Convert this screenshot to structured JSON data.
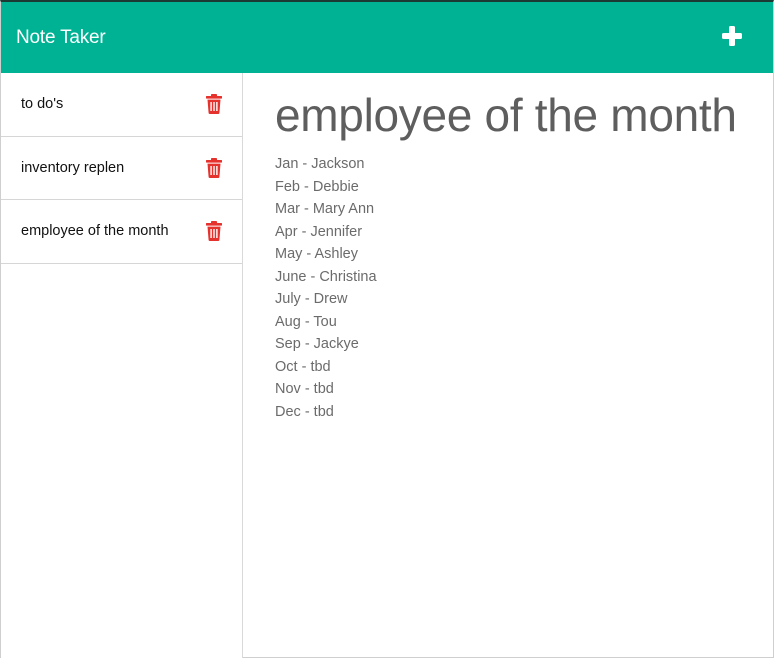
{
  "navbar": {
    "title": "Note Taker",
    "new_note_icon": "plus-icon",
    "bg_color": "#00b294"
  },
  "sidebar": {
    "notes": [
      {
        "title": "to do's",
        "delete_icon": "trash-icon"
      },
      {
        "title": "inventory replen",
        "delete_icon": "trash-icon"
      },
      {
        "title": "employee of the month",
        "delete_icon": "trash-icon"
      }
    ],
    "delete_color": "#e5322d"
  },
  "editor": {
    "title": "employee of the month",
    "body_lines": [
      "Jan - Jackson",
      "Feb - Debbie",
      "Mar - Mary Ann",
      "Apr - Jennifer",
      "May - Ashley",
      "June - Christina",
      "July - Drew",
      "Aug - Tou",
      "Sep - Jackye",
      "Oct - tbd",
      "Nov - tbd",
      "Dec - tbd"
    ]
  }
}
